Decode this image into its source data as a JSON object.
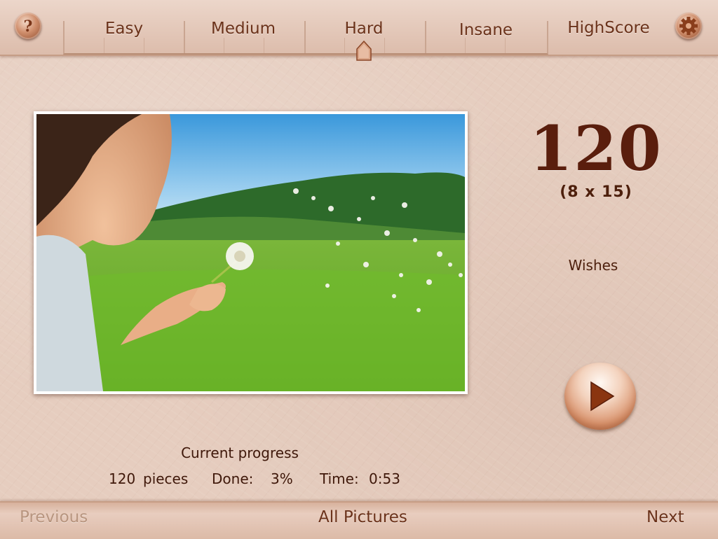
{
  "header": {
    "tabs": [
      {
        "label": "Easy"
      },
      {
        "label": "Medium"
      },
      {
        "label": "Hard"
      },
      {
        "label": "Insane"
      }
    ],
    "highscore_label": "HighScore",
    "selected_tab": "Hard",
    "help_icon": "question-mark-icon",
    "settings_icon": "gear-icon"
  },
  "puzzle": {
    "piece_count": "120",
    "grid": "(8 x 15)",
    "picture_name": "Wishes",
    "play_icon": "play-icon"
  },
  "progress": {
    "title": "Current progress",
    "pieces_value": "120",
    "pieces_label": "pieces",
    "done_label": "Done:",
    "done_value": "3%",
    "time_label": "Time:",
    "time_value": "0:53"
  },
  "footer": {
    "previous": "Previous",
    "all_pictures": "All Pictures",
    "next": "Next"
  },
  "colors": {
    "background": "#e6cdbf",
    "text_brown": "#5a1e0d",
    "disabled_text": "#b8957f"
  }
}
